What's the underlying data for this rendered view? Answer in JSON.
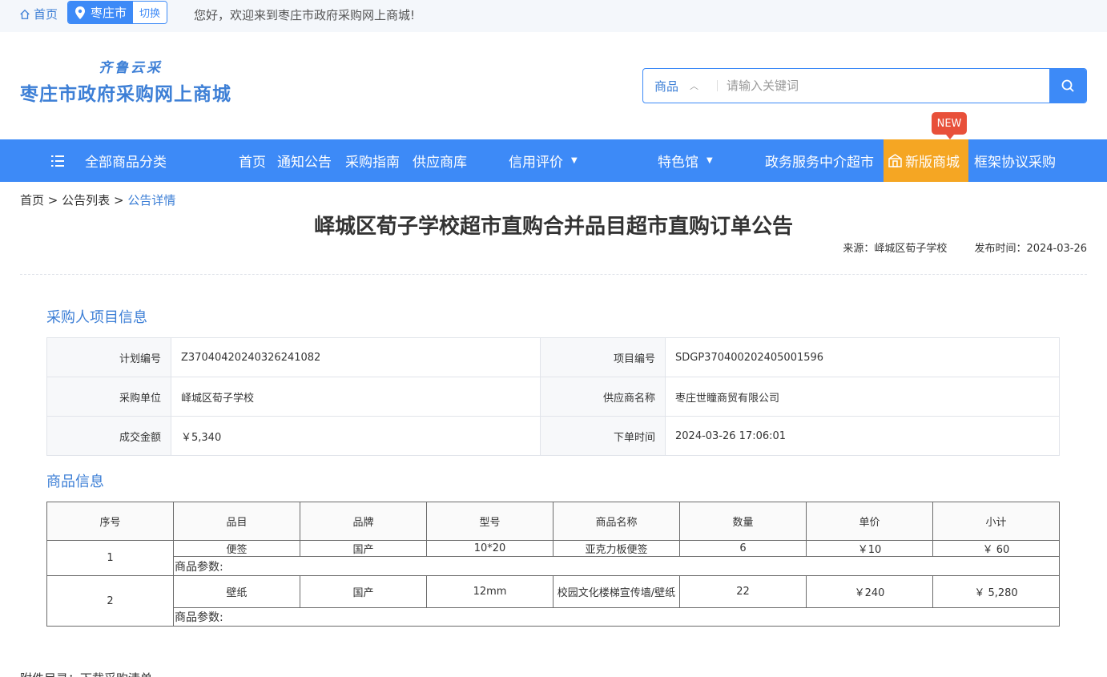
{
  "topbar": {
    "home": "首页",
    "city": "枣庄市",
    "switch": "切换",
    "welcome": "您好，欢迎来到枣庄市政府采购网上商城!"
  },
  "logo": {
    "slogan": "齐鲁云采",
    "title": "枣庄市政府采购网上商城"
  },
  "search": {
    "type": "商品",
    "placeholder": "请输入关键词"
  },
  "nav": {
    "all": "全部商品分类",
    "items": [
      "首页",
      "通知公告",
      "采购指南",
      "供应商库",
      "信用评价",
      "特色馆",
      "政务服务中介超市",
      "新版商城",
      "框架协议采购"
    ],
    "badge": "NEW"
  },
  "breadcrumb": {
    "home": "首页",
    "list": "公告列表",
    "current": "公告详情",
    "sep": ">"
  },
  "notice": {
    "title": "峄城区荀子学校超市直购合并品目超市直购订单公告",
    "source": "来源：峄城区荀子学校",
    "date": "发布时间：2024-03-26"
  },
  "buyer_section": {
    "title": "采购人项目信息",
    "rows": [
      [
        {
          "label": "计划编号",
          "value": "Z37040420240326241082"
        },
        {
          "label": "项目编号",
          "value": "SDGP370400202405001596"
        }
      ],
      [
        {
          "label": "采购单位",
          "value": "峄城区荀子学校"
        },
        {
          "label": "供应商名称",
          "value": "枣庄世瞳商贸有限公司"
        }
      ],
      [
        {
          "label": "成交金额",
          "value": "￥5,340"
        },
        {
          "label": "下单时间",
          "value": "2024-03-26 17:06:01"
        }
      ]
    ]
  },
  "goods_section": {
    "title": "商品信息",
    "headers": [
      "序号",
      "品目",
      "品牌",
      "型号",
      "商品名称",
      "数量",
      "单价",
      "小计"
    ],
    "param_label": "商品参数:",
    "rows": [
      {
        "no": "1",
        "category": "便签",
        "brand": "国产",
        "model": "10*20",
        "name": "亚克力板便签",
        "qty": "6",
        "price": "￥10",
        "subtotal": "￥ 60"
      },
      {
        "no": "2",
        "category": "壁纸",
        "brand": "国产",
        "model": "12mm",
        "name": "校园文化楼梯宣传墙/壁纸",
        "qty": "22",
        "price": "￥240",
        "subtotal": "￥ 5,280"
      }
    ]
  },
  "attachment": "附件目录：下载采购清单",
  "colors": {
    "primary": "#3d8af7",
    "new_tab": "#f5a623",
    "badge": "#e8503a"
  }
}
